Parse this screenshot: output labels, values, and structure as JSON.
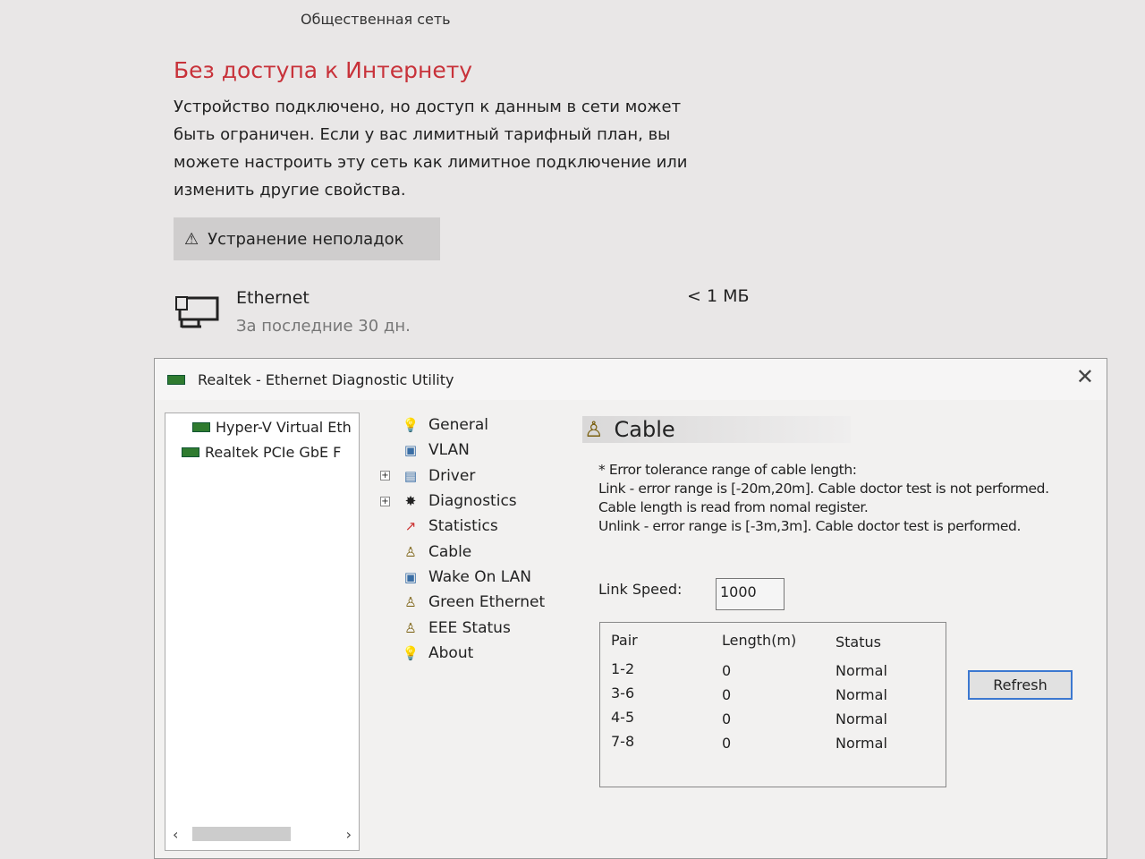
{
  "network": {
    "subtitle": "Общественная сеть",
    "status_title": "Без доступа к Интернету",
    "description": "Устройство подключено, но доступ к данным в сети может быть ограничен. Если у вас лимитный тарифный план, вы можете настроить эту сеть как лимитное подключение или изменить другие свойства.",
    "troubleshoot_label": "Устранение неполадок",
    "usage": {
      "name": "Ethernet",
      "period": "За последние 30 дн.",
      "amount": "< 1 МБ"
    }
  },
  "dialog": {
    "title": "Realtek - Ethernet Diagnostic Utility",
    "adapters": [
      "Hyper-V Virtual Eth",
      "Realtek PCIe GbE F"
    ],
    "tree": [
      {
        "label": "General",
        "icon": "bulb-icon"
      },
      {
        "label": "VLAN",
        "icon": "vlan-icon"
      },
      {
        "label": "Driver",
        "icon": "driver-icon",
        "expandable": true
      },
      {
        "label": "Diagnostics",
        "icon": "diagnostics-icon",
        "expandable": true
      },
      {
        "label": "Statistics",
        "icon": "chart-icon"
      },
      {
        "label": "Cable",
        "icon": "cable-icon"
      },
      {
        "label": "Wake On LAN",
        "icon": "wol-icon"
      },
      {
        "label": "Green Ethernet",
        "icon": "cable-icon"
      },
      {
        "label": "EEE Status",
        "icon": "cable-icon"
      },
      {
        "label": "About",
        "icon": "bulb-icon"
      }
    ],
    "panel": {
      "title": "Cable",
      "info": [
        "* Error tolerance range of cable length:",
        "Link  - error range is [-20m,20m]. Cable doctor test is not performed.",
        "Cable length is read from nomal register.",
        "Unlink  - error range is [-3m,3m]. Cable doctor test is performed."
      ],
      "link_speed_label": "Link Speed:",
      "link_speed": "1000",
      "columns": [
        "Pair",
        "Length(m)",
        "Status"
      ],
      "rows": [
        [
          "1-2",
          "0",
          "Normal"
        ],
        [
          "3-6",
          "0",
          "Normal"
        ],
        [
          "4-5",
          "0",
          "Normal"
        ],
        [
          "7-8",
          "0",
          "Normal"
        ]
      ],
      "refresh_label": "Refresh"
    }
  },
  "colors": {
    "alert": "#c8323a",
    "focus": "#3c78d0"
  }
}
